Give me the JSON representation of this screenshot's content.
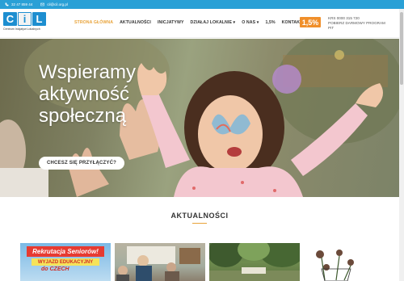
{
  "topbar": {
    "phone": "32 47 859 44",
    "email": "cil@cil.org.pl",
    "bg_color": "#29a0d6"
  },
  "logo": {
    "letters": [
      "C",
      "i",
      "L"
    ],
    "tagline": "Centrum Inicjatyw Lokalnych"
  },
  "nav": {
    "items": [
      {
        "label": "STRONA GŁÓWNA",
        "active": true
      },
      {
        "label": "AKTUALNOŚCI"
      },
      {
        "label": "INICJATYWY"
      },
      {
        "label": "DZIAŁAJ LOKALNIE ▾"
      },
      {
        "label": "O NAS ▾"
      },
      {
        "label": "1,5%"
      },
      {
        "label": "KONTAKT"
      }
    ],
    "active_color": "#e8a33a"
  },
  "badge": {
    "label": "1,5%",
    "color": "#f08f2a"
  },
  "krs": {
    "line1": "KRS 0000 315 720",
    "line2": "POBIERZ DARMOWY PROGRAM",
    "line3": "PIT"
  },
  "hero": {
    "title_line1": "Wspieramy",
    "title_line2": "aktywność",
    "title_line3": "społeczną",
    "cta_label": "CHCESZ SIĘ PRZYŁĄCZYĆ?"
  },
  "news": {
    "title": "AKTUALNOŚCI",
    "card1": {
      "ribbon": "Rekrutacja Seniorów!",
      "sub": "WYJAZD EDUKACYJNY",
      "sub2": "do CZECH"
    }
  }
}
